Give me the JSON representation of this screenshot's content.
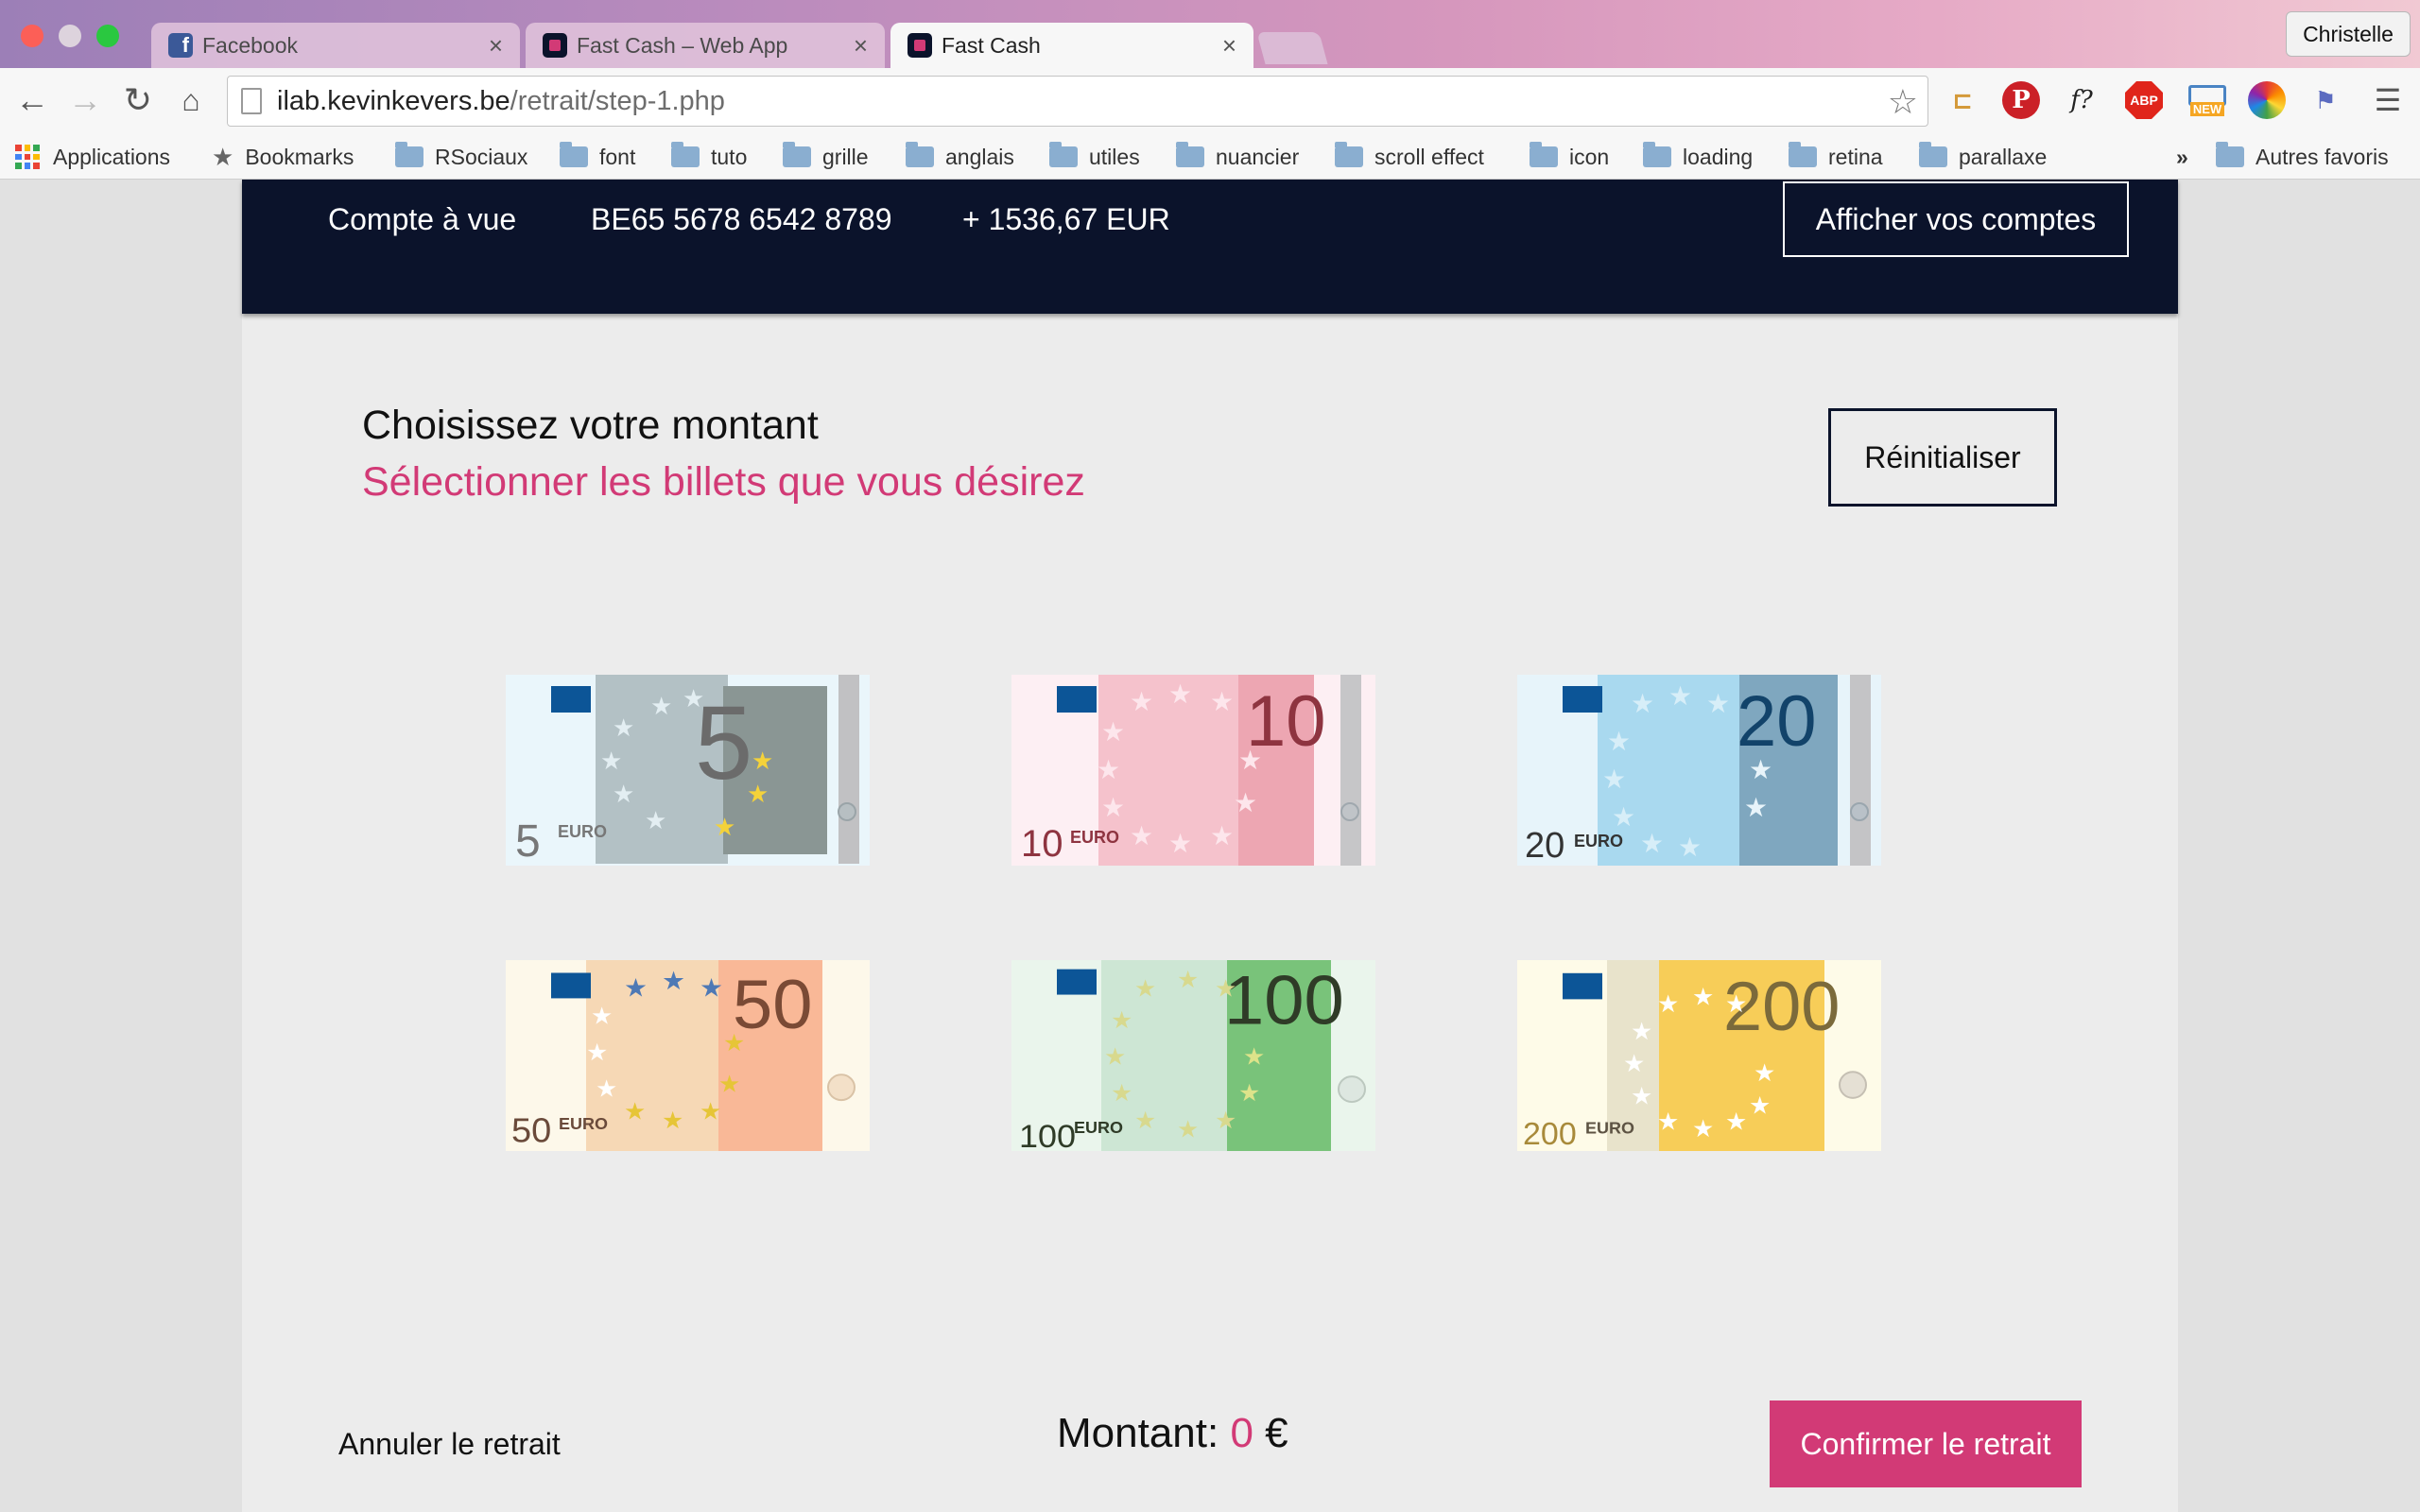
{
  "browser": {
    "tabs": [
      {
        "title": "Facebook",
        "favicon": "facebook-icon"
      },
      {
        "title": "Fast Cash – Web App",
        "favicon": "fastcash-icon"
      },
      {
        "title": "Fast Cash",
        "favicon": "fastcash-icon"
      }
    ],
    "profile": "Christelle",
    "url_host": "ilab.kevinkevers.be",
    "url_path": "/retrait/step-1.php",
    "bookmarks": [
      "Applications",
      "Bookmarks",
      "RSociaux",
      "font",
      "tuto",
      "grille",
      "anglais",
      "utiles",
      "nuancier",
      "scroll effect",
      "icon",
      "loading",
      "retina",
      "parallaxe"
    ],
    "other_bookmarks": "Autres favoris",
    "overflow": "»"
  },
  "account": {
    "type": "Compte à vue",
    "iban": "BE65 5678 6542 8789",
    "balance": "+ 1536,67 EUR",
    "show_accounts": "Afficher vos comptes"
  },
  "main": {
    "title": "Choisissez votre montant",
    "subtitle": "Sélectionner les billets que vous désirez",
    "reset": "Réinitialiser"
  },
  "banknotes": [
    {
      "value": "5",
      "currency": "EURO",
      "color": "#aebdc2"
    },
    {
      "value": "10",
      "currency": "EURO",
      "color": "#f2a4b4"
    },
    {
      "value": "20",
      "currency": "EURO",
      "color": "#a9d9ef"
    },
    {
      "value": "50",
      "currency": "EURO",
      "color": "#f8b796"
    },
    {
      "value": "100",
      "currency": "EURO",
      "color": "#79c37a"
    },
    {
      "value": "200",
      "currency": "EURO",
      "color": "#f7cd58"
    }
  ],
  "footer": {
    "cancel": "Annuler le retrait",
    "amount_label": "Montant:",
    "amount_value": "0",
    "amount_currency": "€",
    "confirm": "Confirmer le retrait"
  },
  "colors": {
    "accent": "#d23a76",
    "navy": "#0b132b",
    "page": "#ececec"
  }
}
